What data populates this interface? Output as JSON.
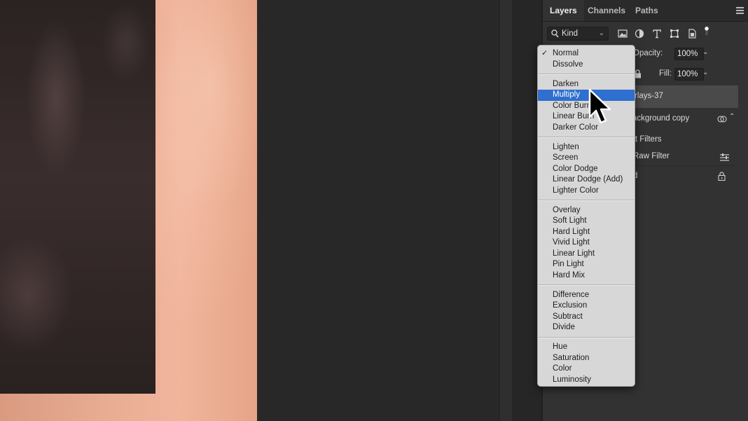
{
  "canvas": {},
  "layers_panel": {
    "tabs": [
      "Layers",
      "Channels",
      "Paths"
    ],
    "filter": {
      "kind_label": "Kind"
    },
    "opacity": {
      "label": "Opacity:",
      "value": "100%"
    },
    "fill": {
      "label": "Fill:",
      "value": "100%"
    },
    "layers": [
      {
        "name": "rlays-37",
        "selected": true
      },
      {
        "name": "ackground copy",
        "selected": false
      }
    ],
    "smart_filters_label": "rt Filters",
    "filter_name": "Raw Filter",
    "locked_layer_name": "d"
  },
  "blend_menu": {
    "checked_item": "Normal",
    "highlighted_item": "Multiply",
    "groups": [
      [
        "Normal",
        "Dissolve"
      ],
      [
        "Darken",
        "Multiply",
        "Color Burn",
        "Linear Burn",
        "Darker Color"
      ],
      [
        "Lighten",
        "Screen",
        "Color Dodge",
        "Linear Dodge (Add)",
        "Lighter Color"
      ],
      [
        "Overlay",
        "Soft Light",
        "Hard Light",
        "Vivid Light",
        "Linear Light",
        "Pin Light",
        "Hard Mix"
      ],
      [
        "Difference",
        "Exclusion",
        "Subtract",
        "Divide"
      ],
      [
        "Hue",
        "Saturation",
        "Color",
        "Luminosity"
      ]
    ]
  },
  "colors": {
    "menu_highlight": "#2e6fcf",
    "panel_bg": "#323232",
    "skin_tone": "#e8ac93"
  }
}
